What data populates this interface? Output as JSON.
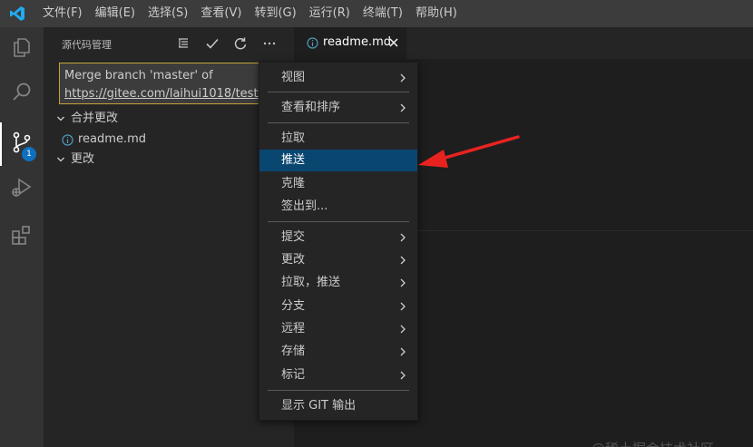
{
  "menubar": {
    "items": [
      "文件(F)",
      "编辑(E)",
      "选择(S)",
      "查看(V)",
      "转到(G)",
      "运行(R)",
      "终端(T)",
      "帮助(H)"
    ]
  },
  "activitybar": {
    "icons": [
      "files-icon",
      "search-icon",
      "source-control-icon",
      "run-debug-icon",
      "extensions-icon"
    ],
    "scm_badge": "1"
  },
  "sidebar": {
    "title": "源代码管理",
    "commit_message": {
      "line1": "Merge branch 'master' of",
      "line2": "https://gitee.com/laihui1018/test"
    },
    "groups": {
      "merge_changes": "合并更改",
      "merge_file": "readme.md",
      "changes": "更改"
    }
  },
  "editor": {
    "tab_label": "readme.md"
  },
  "context_menu": {
    "items": [
      {
        "label": "视图",
        "submenu": true
      },
      {
        "label": "查看和排序",
        "submenu": true
      },
      {
        "label": "拉取",
        "submenu": false
      },
      {
        "label": "推送",
        "submenu": false,
        "highlighted": true
      },
      {
        "label": "克隆",
        "submenu": false
      },
      {
        "label": "签出到...",
        "submenu": false
      },
      {
        "label": "提交",
        "submenu": true
      },
      {
        "label": "更改",
        "submenu": true
      },
      {
        "label": "拉取，推送",
        "submenu": true
      },
      {
        "label": "分支",
        "submenu": true
      },
      {
        "label": "远程",
        "submenu": true
      },
      {
        "label": "存储",
        "submenu": true
      },
      {
        "label": "标记",
        "submenu": true
      },
      {
        "label": "显示 GIT 输出",
        "submenu": false
      }
    ]
  },
  "watermark": "@稀土掘金技术社区",
  "colors": {
    "accent": "#0e70c0",
    "highlight": "#094771",
    "annotation": "#e8231f",
    "commit_border": "#c2a23a"
  }
}
